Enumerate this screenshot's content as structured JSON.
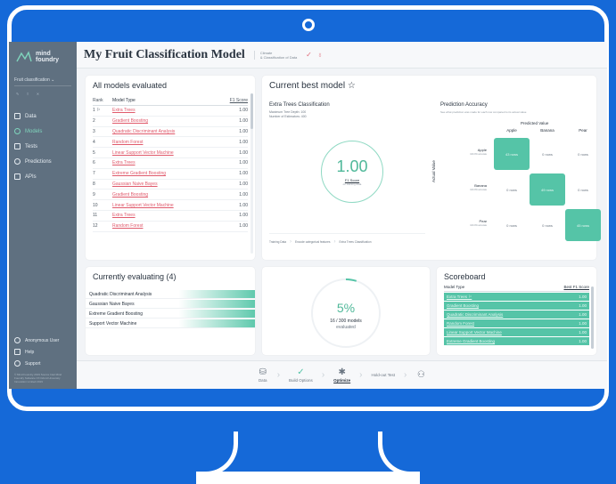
{
  "app": {
    "brand": [
      "mind",
      "foundry"
    ],
    "title": "My Fruit Classification Model",
    "meta_lines": [
      "Climate",
      "& Classification of Data"
    ]
  },
  "sidebar": {
    "project": "Fruit classification ⌄",
    "nav": [
      {
        "label": "Data",
        "icon": "folder-icon",
        "active": false
      },
      {
        "label": "Models",
        "icon": "model-icon",
        "active": true
      },
      {
        "label": "Tests",
        "icon": "flask-icon",
        "active": false
      },
      {
        "label": "Predictions",
        "icon": "chart-icon",
        "active": false
      },
      {
        "label": "APIs",
        "icon": "api-icon",
        "active": false
      }
    ],
    "bottom": [
      {
        "label": "Anonymous User",
        "icon": "user-icon"
      },
      {
        "label": "Help",
        "icon": "help-icon"
      },
      {
        "label": "Support",
        "icon": "support-icon"
      }
    ],
    "copyright": "© Mind Foundry 2019 Source Intel Mind Foundry Software Of Oxford University Innovation Limited 2019"
  },
  "all_models": {
    "title": "All models evaluated",
    "headers": {
      "rank": "Rank",
      "type": "Model Type",
      "score": "F1 Score"
    },
    "rows": [
      {
        "rank": "1 ⚐",
        "type": "Extra Trees",
        "score": "1.00"
      },
      {
        "rank": "2",
        "type": "Gradient Boosting",
        "score": "1.00"
      },
      {
        "rank": "3",
        "type": "Quadratic Discriminant Analysis",
        "score": "1.00"
      },
      {
        "rank": "4",
        "type": "Random Forest",
        "score": "1.00"
      },
      {
        "rank": "5",
        "type": "Linear Support Vector Machine",
        "score": "1.00"
      },
      {
        "rank": "6",
        "type": "Extra Trees",
        "score": "1.00"
      },
      {
        "rank": "7",
        "type": "Extreme Gradient Boosting",
        "score": "1.00"
      },
      {
        "rank": "8",
        "type": "Gaussian Naive Bayes",
        "score": "1.00"
      },
      {
        "rank": "9",
        "type": "Gradient Boosting",
        "score": "1.00"
      },
      {
        "rank": "10",
        "type": "Linear Support Vector Machine",
        "score": "1.00"
      },
      {
        "rank": "11",
        "type": "Extra Trees",
        "score": "1.00"
      },
      {
        "rank": "12",
        "type": "Random Forest",
        "score": "1.00"
      }
    ]
  },
  "best": {
    "title": "Current best model ☆",
    "model": "Extra Trees Classification",
    "meta": [
      "Maximum Tree Depth: 100",
      "Number of Estimators: 400"
    ],
    "score": "1.00",
    "score_label": "F1 Score",
    "score_sub": "on training data",
    "pipeline": [
      "Training Data",
      "Encode categorical features",
      "Extra Trees Classification"
    ],
    "accuracy": {
      "title": "Prediction Accuracy",
      "subtitle": "See what prediction was made for each row compared to its actual value",
      "predicted_label": "Predicted Value",
      "actual_label": "Actual Value",
      "classes": [
        "Apple",
        "Banana",
        "Pear"
      ],
      "row_subs": [
        "100.0% accurate",
        "100.0% accurate",
        "100.0% accurate"
      ],
      "cells": [
        [
          "43 rows",
          "0 rows",
          "0 rows"
        ],
        [
          "0 rows",
          "49 rows",
          "0 rows"
        ],
        [
          "0 rows",
          "0 rows",
          "45 rows"
        ]
      ]
    }
  },
  "evaluating": {
    "title": "Currently evaluating (4)",
    "items": [
      "Quadratic Discriminant Analysis",
      "Gaussian Naive Bayes",
      "Extreme Gradient Boosting",
      "Support Vector Machine"
    ]
  },
  "progress": {
    "percent": "5%",
    "fraction": 0.05,
    "count": "16 / 300 models",
    "sub": "evaluated"
  },
  "scoreboard": {
    "title": "Scoreboard",
    "headers": {
      "type": "Model Type",
      "score": "Best F1 Score"
    },
    "rows": [
      {
        "type": "Extra Trees ⚐",
        "score": "1.00"
      },
      {
        "type": "Gradient Boosting",
        "score": "1.00"
      },
      {
        "type": "Quadratic Discriminant Analysis",
        "score": "1.00"
      },
      {
        "type": "Random Forest",
        "score": "1.00"
      },
      {
        "type": "Linear Support Vector Machine",
        "score": "1.00"
      },
      {
        "type": "Extreme Gradient Boosting",
        "score": "1.00"
      }
    ]
  },
  "steps": [
    {
      "label": "Data",
      "state": "todo",
      "icon": "database-icon"
    },
    {
      "label": "Build Options",
      "state": "done",
      "icon": "check-icon"
    },
    {
      "label": "Optimize",
      "state": "active",
      "icon": "spinner-icon"
    },
    {
      "label": "Hold-out Test",
      "state": "todo",
      "icon": ""
    },
    {
      "label": "",
      "state": "todo",
      "icon": "deploy-icon"
    }
  ],
  "colors": {
    "accent": "#55c4a7",
    "link": "#e05a6c",
    "sidebar": "#5f7080",
    "background": "#1569d8"
  }
}
